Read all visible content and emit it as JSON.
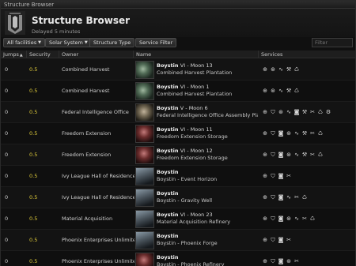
{
  "window": {
    "title": "Structure Browser"
  },
  "header": {
    "title": "Structure Browser",
    "subtitle": "Delayed 5 minutes"
  },
  "filters": {
    "facilities": "All facilities",
    "range": "Solar System",
    "structure_type": "Structure Type",
    "service_filter": "Service Filter",
    "search_placeholder": "Filter"
  },
  "columns": [
    "Jumps",
    "Security",
    "Owner",
    "Name",
    "Services"
  ],
  "rows": [
    {
      "jumps": "0",
      "security": "0.5",
      "owner": "Combined Harvest",
      "system": "Boystin",
      "location": "VI - Moon 13",
      "type": "Combined Harvest Plantation",
      "thumb": "green",
      "services": [
        "s1",
        "s2",
        "s3",
        "s4",
        "s5"
      ]
    },
    {
      "jumps": "0",
      "security": "0.5",
      "owner": "Combined Harvest",
      "system": "Boystin",
      "location": "VI - Moon 1",
      "type": "Combined Harvest Plantation",
      "thumb": "green",
      "services": [
        "s1",
        "s2",
        "s3",
        "s4",
        "s5"
      ]
    },
    {
      "jumps": "0",
      "security": "0.5",
      "owner": "Federal Intelligence Office",
      "system": "Boystin",
      "location": "V - Moon 6",
      "type": "Federal Intelligence Office Assembly Plant",
      "thumb": "tan",
      "services": [
        "s1",
        "s6",
        "s2",
        "s3",
        "s7",
        "s4",
        "s8",
        "s5",
        "s9"
      ]
    },
    {
      "jumps": "0",
      "security": "0.5",
      "owner": "Freedom Extension",
      "system": "Boystin",
      "location": "VI - Moon 11",
      "type": "Freedom Extension Storage",
      "thumb": "red",
      "services": [
        "s1",
        "s6",
        "s7",
        "s2",
        "s3",
        "s4",
        "s8",
        "s5"
      ]
    },
    {
      "jumps": "0",
      "security": "0.5",
      "owner": "Freedom Extension",
      "system": "Boystin",
      "location": "VI - Moon 12",
      "type": "Freedom Extension Storage",
      "thumb": "red",
      "services": [
        "s1",
        "s6",
        "s7",
        "s2",
        "s3",
        "s4",
        "s8",
        "s5"
      ]
    },
    {
      "jumps": "0",
      "security": "0.5",
      "owner": "Ivy League Hall of Residence",
      "system": "Boystin",
      "location": "",
      "type": "Boystin - Event Horizon",
      "thumb": "gray",
      "services": [
        "s1",
        "s6",
        "s7",
        "s8"
      ]
    },
    {
      "jumps": "0",
      "security": "0.5",
      "owner": "Ivy League Hall of Residence",
      "system": "Boystin",
      "location": "",
      "type": "Boystin - Gravity Well",
      "thumb": "gray",
      "services": [
        "s1",
        "s6",
        "s7",
        "s3",
        "s8",
        "s5"
      ]
    },
    {
      "jumps": "0",
      "security": "0.5",
      "owner": "Material Acquisition",
      "system": "Boystin",
      "location": "VI - Moon 23",
      "type": "Material Acquisition Refinery",
      "thumb": "gray",
      "services": [
        "s1",
        "s6",
        "s7",
        "s2",
        "s3",
        "s8",
        "s5"
      ]
    },
    {
      "jumps": "0",
      "security": "0.5",
      "owner": "Phoenix Enterprises Unlimited",
      "system": "Boystin",
      "location": "",
      "type": "Boystin - Phoenix Forge",
      "thumb": "gray",
      "services": [
        "s1",
        "s6",
        "s7",
        "s8"
      ]
    },
    {
      "jumps": "0",
      "security": "0.5",
      "owner": "Phoenix Enterprises Unlimited",
      "system": "Boystin",
      "location": "",
      "type": "Boystin - Phoenix Refinery",
      "thumb": "red",
      "services": [
        "s1",
        "s6",
        "s7",
        "s2",
        "s8"
      ]
    }
  ]
}
